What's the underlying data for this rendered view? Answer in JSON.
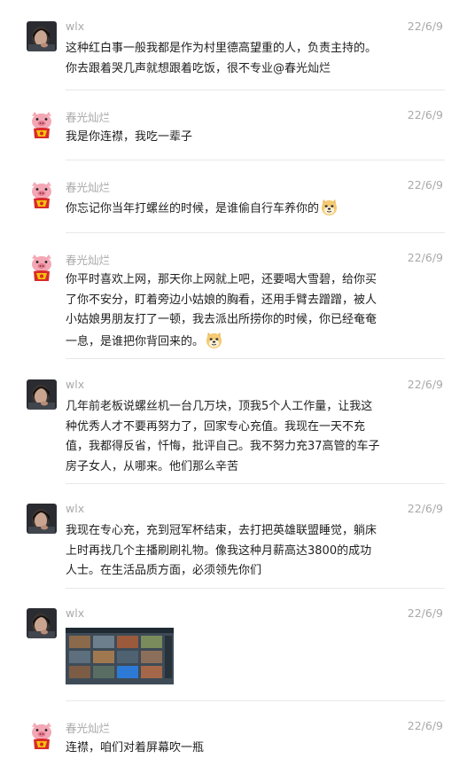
{
  "messages": [
    {
      "sender": "wlx",
      "date": "22/6/9",
      "avatar": "person-photo",
      "text": "这种红白事一般我都是作为村里德高望重的人，负责主持的。你去跟着哭几声就想跟着吃饭，很不专业@春光灿烂",
      "emoji": null
    },
    {
      "sender": "春光灿烂",
      "date": "22/6/9",
      "avatar": "pig-mascot",
      "text": "我是你连襟，我吃一辈子",
      "emoji": null
    },
    {
      "sender": "春光灿烂",
      "date": "22/6/9",
      "avatar": "pig-mascot",
      "text": "你忘记你当年打螺丝的时候，是谁偷自行车养你的",
      "emoji": "doge-emoji"
    },
    {
      "sender": "春光灿烂",
      "date": "22/6/9",
      "avatar": "pig-mascot",
      "text": "你平时喜欢上网，那天你上网就上吧，还要喝大雪碧，给你买了你不安分，盯着旁边小姑娘的胸看，还用手臂去蹭蹭，被人小姑娘男朋友打了一顿，我去派出所捞你的时候，你已经奄奄一息，是谁把你背回来的。",
      "emoji": "doge-emoji"
    },
    {
      "sender": "wlx",
      "date": "22/6/9",
      "avatar": "person-photo",
      "text": "几年前老板说螺丝机一台几万块，顶我5个人工作量，让我这种优秀人才不要再努力了，回家专心充值。我现在一天不充值，我都得反省，忏悔，批评自己。我不努力充37高管的车子房子女人，从哪来。他们那么辛苦",
      "emoji": null
    },
    {
      "sender": "wlx",
      "date": "22/6/9",
      "avatar": "person-photo",
      "text": "我现在专心充，充到冠军杯结束，去打把英雄联盟睡觉，躺床上时再找几个主播刷刷礼物。像我这种月薪高达3800的成功人士。在生活品质方面，必须领先你们",
      "emoji": null
    },
    {
      "sender": "wlx",
      "date": "22/6/9",
      "avatar": "person-photo",
      "text": "",
      "emoji": null,
      "image": "game-screenshot"
    },
    {
      "sender": "春光灿烂",
      "date": "22/6/9",
      "avatar": "pig-mascot",
      "text": "连襟，咱们对着屏幕吹一瓶",
      "emoji": null
    }
  ]
}
